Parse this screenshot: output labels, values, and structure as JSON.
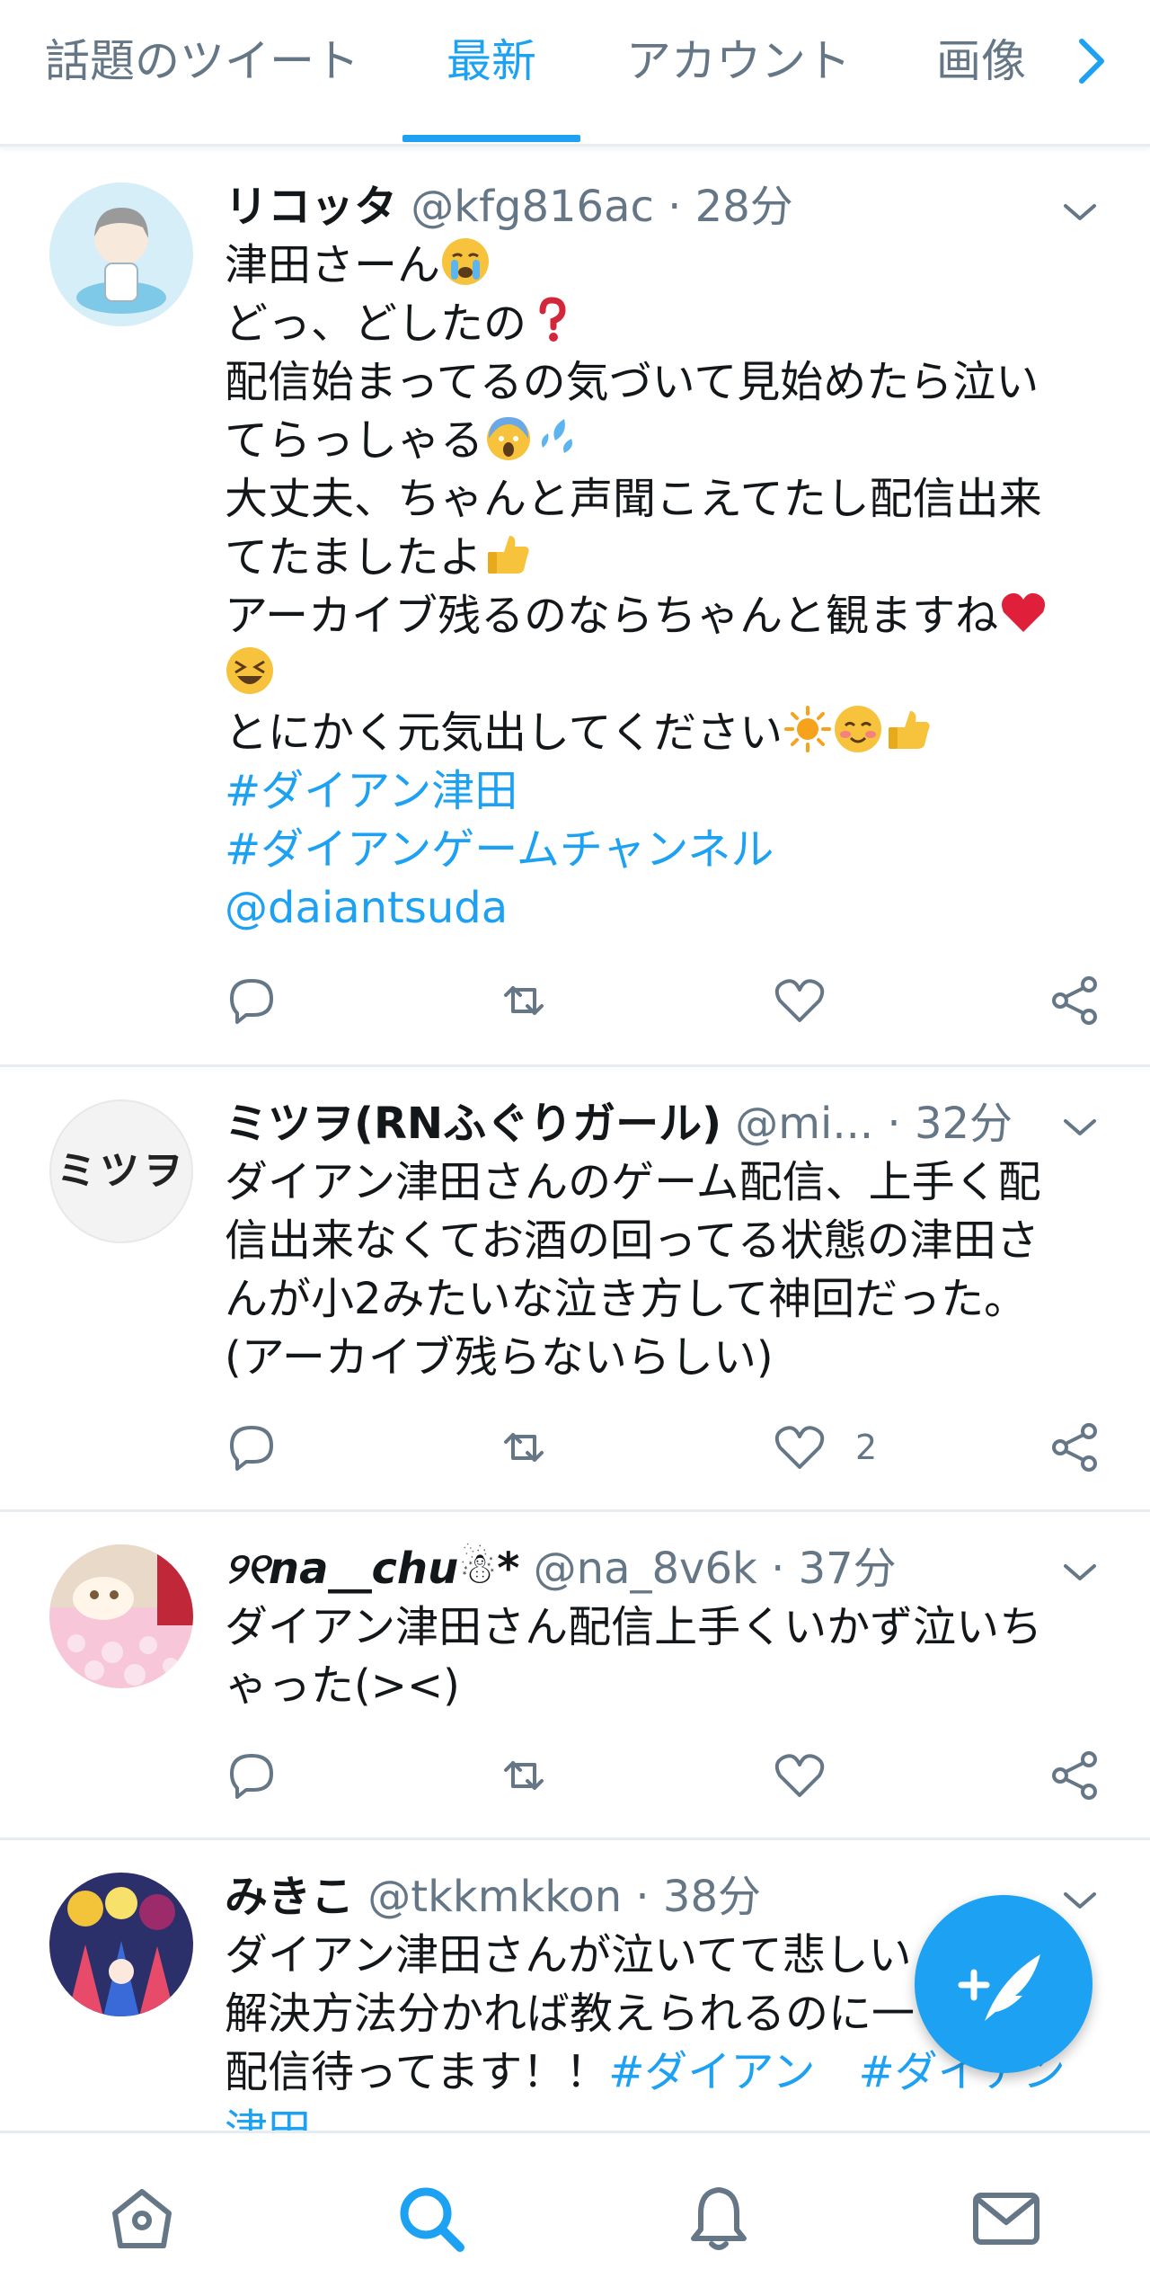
{
  "tabs": [
    {
      "label": "話題のツイート",
      "active": false
    },
    {
      "label": "最新",
      "active": true
    },
    {
      "label": "アカウント",
      "active": false
    },
    {
      "label": "画像",
      "active": false
    }
  ],
  "accent_color": "#1da1f2",
  "tweets": [
    {
      "name": "リコッタ",
      "handle": "@kfg816ac",
      "time": "· 28分",
      "lines": [
        "津田さーん",
        "どっ、どしたの",
        "配信始まってるの気づいて見始めたら泣い",
        "てらっしゃる",
        "大丈夫、ちゃんと声聞こえてたし配信出来",
        "てたましたよ",
        "アーカイブ残るのならちゃんと観ますね",
        "",
        "とにかく元気出してください"
      ],
      "hashtags": [
        "#ダイアン津田",
        "#ダイアンゲームチャンネル"
      ],
      "mention": "@daiantsuda",
      "likes": ""
    },
    {
      "name": "ミツヲ(RNふぐりガール)",
      "handle": "@mi...",
      "time": "· 32分",
      "avatar_text": "ミツヲ",
      "lines": [
        "ダイアン津田さんのゲーム配信、上手く配",
        "信出来なくてお酒の回ってる状態の津田さ",
        "んが小2みたいな泣き方して神回だった。",
        "(アーカイブ残らないらしい)"
      ],
      "likes": "2"
    },
    {
      "name": "୨୧na__chu☃︎*",
      "handle": "@na_8v6k",
      "time": "· 37分",
      "lines": [
        "ダイアン津田さん配信上手くいかず泣いち",
        "ゃった(><)"
      ],
      "likes": ""
    },
    {
      "name": "みきこ",
      "handle": "@tkkmkkon",
      "time": "· 38分",
      "lines": [
        "ダイアン津田さんが泣いてて悲しい",
        "解決方法分かれば教えられるのに一",
        "配信待ってます！！"
      ],
      "hashtags": [
        "#ダイアン",
        "#ダイアン",
        "津田"
      ]
    }
  ],
  "icons": {
    "reply": "reply-icon",
    "retweet": "retweet-icon",
    "like": "heart-icon",
    "share": "share-icon",
    "compose": "compose-tweet-icon",
    "home": "home-icon",
    "search": "search-icon",
    "notifications": "bell-icon",
    "messages": "mail-icon"
  }
}
